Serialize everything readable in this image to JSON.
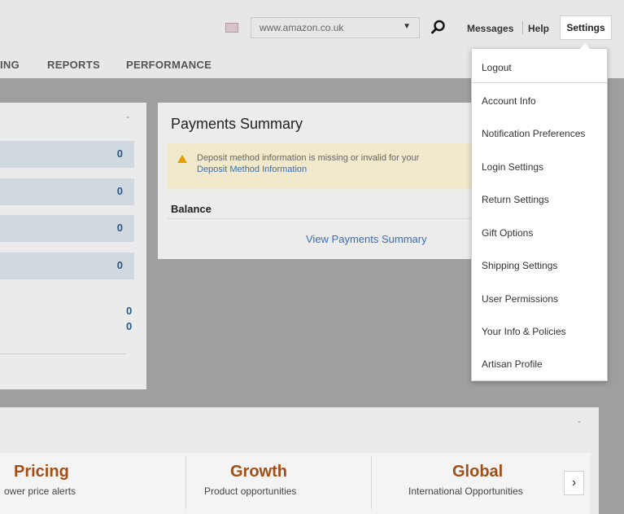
{
  "header": {
    "marketplace": "www.amazon.co.uk",
    "links": {
      "messages": "Messages",
      "help": "Help",
      "settings": "Settings"
    }
  },
  "nav": {
    "items": [
      "ING",
      "REPORTS",
      "PERFORMANCE"
    ]
  },
  "left_panel": {
    "collapse": "-",
    "values": [
      "0",
      "0",
      "0",
      "0",
      "0",
      "0"
    ]
  },
  "payments": {
    "title": "Payments Summary",
    "alert_text": "Deposit method information is missing or invalid for your",
    "alert_link": "Deposit Method Information",
    "balance_label": "Balance",
    "view_link": "View Payments Summary"
  },
  "bottom": {
    "collapse": "-",
    "cards": [
      {
        "title": "Pricing",
        "subtitle": "ower price alerts"
      },
      {
        "title": "Growth",
        "subtitle": "Product opportunities"
      },
      {
        "title": "Global",
        "subtitle": "International Opportunities"
      }
    ],
    "next": "›"
  },
  "settings_menu": {
    "items": [
      "Logout",
      "Account Info",
      "Notification Preferences",
      "Login Settings",
      "Return Settings",
      "Gift Options",
      "Shipping Settings",
      "User Permissions",
      "Your Info & Policies",
      "Artisan Profile"
    ]
  },
  "icons": {
    "flag": "uk-flag-icon",
    "search": "search-icon",
    "warning": "warning-icon",
    "next": "chevron-right-icon"
  }
}
